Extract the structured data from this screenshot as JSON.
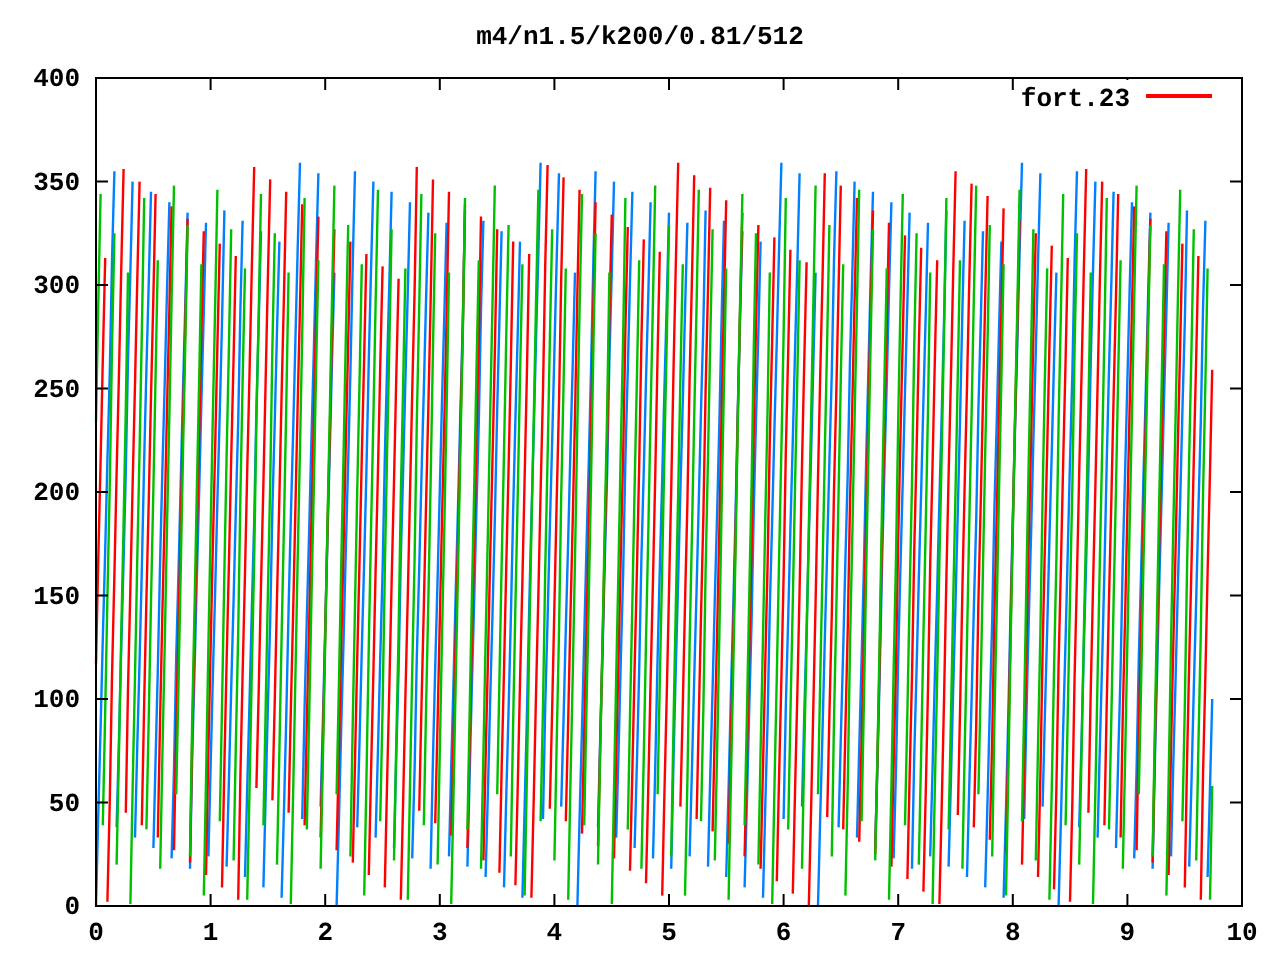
{
  "chart": {
    "title": "m4/n1.5/k200/0.81/512",
    "legend": {
      "label": "fort.23",
      "color": "#ff0000"
    },
    "x_ticks": [
      "0",
      "1",
      "2",
      "3",
      "4",
      "5",
      "6",
      "7",
      "8",
      "9",
      "10"
    ],
    "y_ticks": [
      "400",
      "350",
      "300",
      "250",
      "200",
      "150",
      "100",
      "50",
      "0"
    ]
  }
}
